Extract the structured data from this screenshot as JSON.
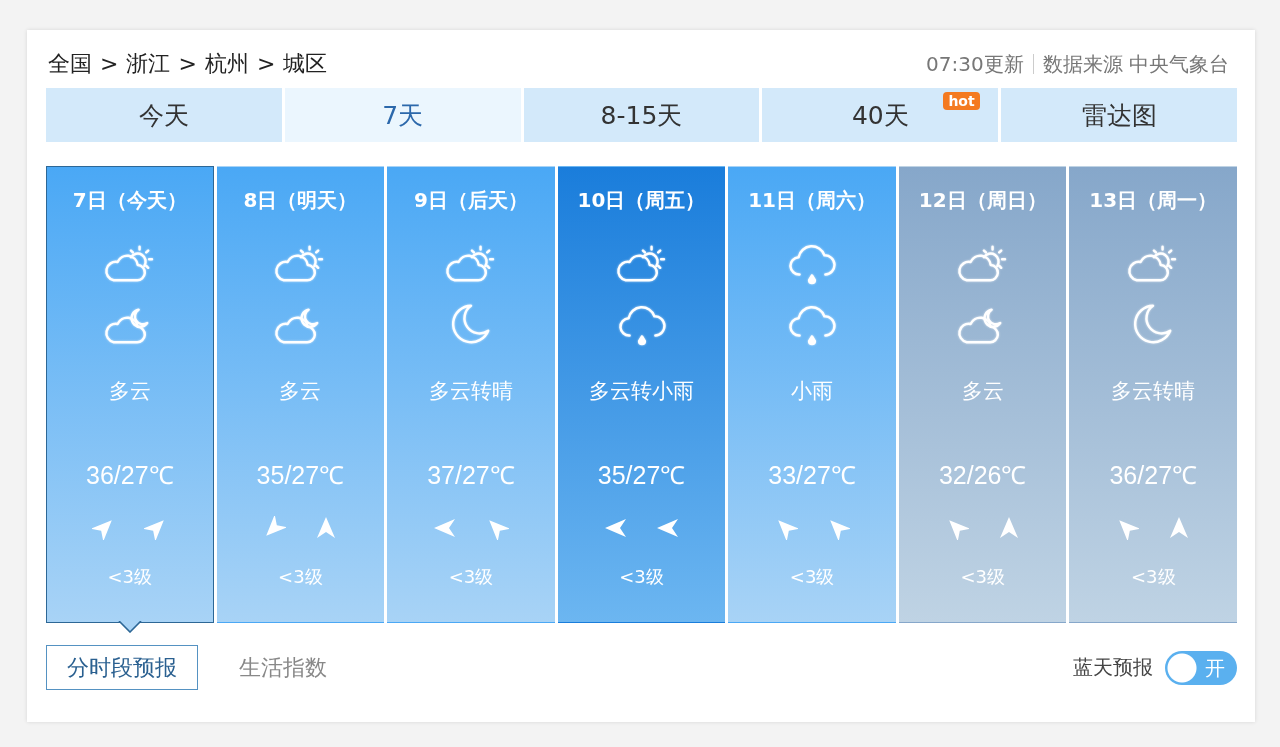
{
  "breadcrumb": {
    "items": [
      "全国",
      "浙江",
      "杭州",
      "城区"
    ],
    "separators": [
      ">",
      ">",
      ">"
    ]
  },
  "update": {
    "time": "07:30更新",
    "source": "数据来源 中央气象台"
  },
  "tabs": [
    {
      "label": "今天",
      "selected": false
    },
    {
      "label": "7天",
      "selected": true
    },
    {
      "label": "8-15天",
      "selected": false
    },
    {
      "label": "40天",
      "selected": false,
      "badge": "hot"
    },
    {
      "label": "雷达图",
      "selected": false
    }
  ],
  "days": [
    {
      "date": "7日（今天）",
      "day_icon": {
        "kind": "partly-cloudy"
      },
      "night_icon": {
        "kind": "partly-cloudy"
      },
      "condition": "多云",
      "temperature": "36/27℃",
      "wind": {
        "day": {
          "kind": "ne"
        },
        "night": {
          "kind": "ne"
        },
        "level": "<3级"
      },
      "selected": true,
      "highlighted": false,
      "faded": false
    },
    {
      "date": "8日（明天）",
      "day_icon": {
        "kind": "partly-cloudy"
      },
      "night_icon": {
        "kind": "partly-cloudy"
      },
      "condition": "多云",
      "temperature": "35/27℃",
      "wind": {
        "day": {
          "kind": "sw"
        },
        "night": {
          "kind": "n"
        },
        "level": "<3级"
      },
      "selected": false,
      "highlighted": false,
      "faded": false
    },
    {
      "date": "9日（后天）",
      "day_icon": {
        "kind": "partly-cloudy"
      },
      "night_icon": {
        "kind": "clear"
      },
      "condition": "多云转晴",
      "temperature": "37/27℃",
      "wind": {
        "day": {
          "kind": "w"
        },
        "night": {
          "kind": "nw"
        },
        "level": "<3级"
      },
      "selected": false,
      "highlighted": false,
      "faded": false
    },
    {
      "date": "10日（周五）",
      "day_icon": {
        "kind": "partly-cloudy"
      },
      "night_icon": {
        "kind": "rain"
      },
      "condition": "多云转小雨",
      "temperature": "35/27℃",
      "wind": {
        "day": {
          "kind": "w"
        },
        "night": {
          "kind": "w"
        },
        "level": "<3级"
      },
      "selected": false,
      "highlighted": true,
      "faded": false
    },
    {
      "date": "11日（周六）",
      "day_icon": {
        "kind": "rain"
      },
      "night_icon": {
        "kind": "rain"
      },
      "condition": "小雨",
      "temperature": "33/27℃",
      "wind": {
        "day": {
          "kind": "nw"
        },
        "night": {
          "kind": "nw"
        },
        "level": "<3级"
      },
      "selected": false,
      "highlighted": false,
      "faded": false
    },
    {
      "date": "12日（周日）",
      "day_icon": {
        "kind": "partly-cloudy"
      },
      "night_icon": {
        "kind": "partly-cloudy"
      },
      "condition": "多云",
      "temperature": "32/26℃",
      "wind": {
        "day": {
          "kind": "nw"
        },
        "night": {
          "kind": "n"
        },
        "level": "<3级"
      },
      "selected": false,
      "highlighted": false,
      "faded": true
    },
    {
      "date": "13日（周一）",
      "day_icon": {
        "kind": "partly-cloudy"
      },
      "night_icon": {
        "kind": "clear"
      },
      "condition": "多云转晴",
      "temperature": "36/27℃",
      "wind": {
        "day": {
          "kind": "nw"
        },
        "night": {
          "kind": "n"
        },
        "level": "<3级"
      },
      "selected": false,
      "highlighted": false,
      "faded": true
    }
  ],
  "subtabs": [
    {
      "label": "分时段预报",
      "selected": true
    },
    {
      "label": "生活指数",
      "selected": false
    }
  ],
  "toggle": {
    "label": "蓝天预报",
    "on": true,
    "text": "开"
  }
}
